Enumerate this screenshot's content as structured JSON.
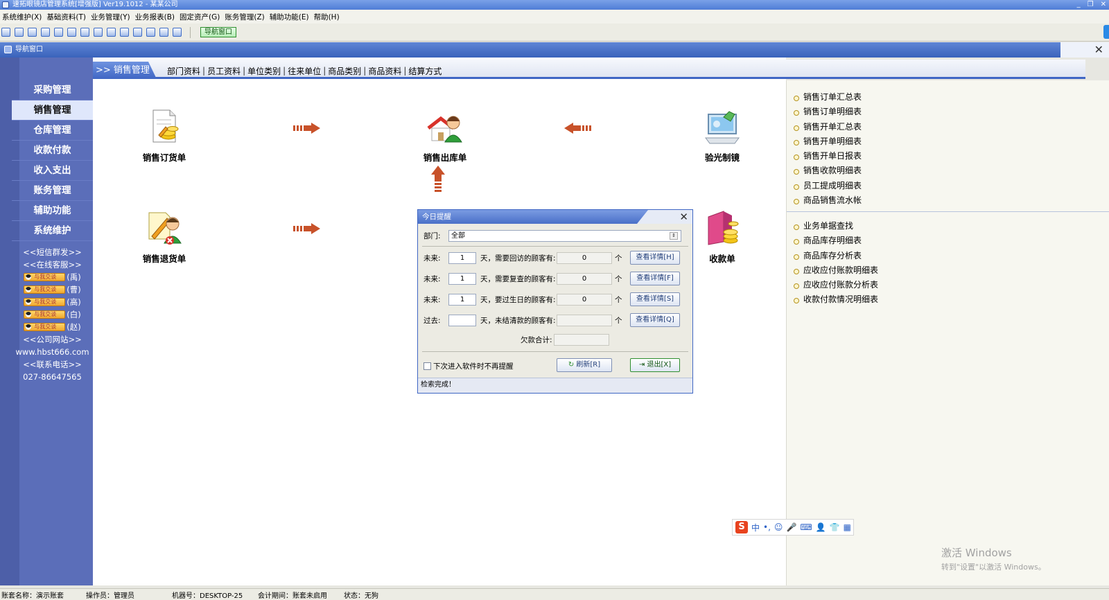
{
  "window": {
    "title": "速拓眼镜店管理系统[增强版] Ver19.1012 - 某某公司",
    "controls": [
      "_",
      "❐",
      "✕"
    ]
  },
  "menubar": [
    "系统维护(X)",
    "基础资料(T)",
    "业务管理(Y)",
    "业务报表(B)",
    "固定资产(G)",
    "账务管理(Z)",
    "辅助功能(E)",
    "帮助(H)"
  ],
  "toolbar": {
    "nav_button": "导航窗口"
  },
  "nav_window": {
    "title": "导航窗口",
    "close": "✕"
  },
  "sidebar": {
    "items": [
      "采购管理",
      "销售管理",
      "仓库管理",
      "收款付款",
      "收入支出",
      "账务管理",
      "辅助功能",
      "系统维护"
    ],
    "active_index": 1,
    "sms": "<<短信群发>>",
    "online": "<<在线客服>>",
    "qq_badge": "与我交谈",
    "qq_contacts": [
      "(禹)",
      "(曹)",
      "(高)",
      "(白)",
      "(赵)"
    ],
    "site_label": "<<公司网站>>",
    "site_url": "www.hbst666.com",
    "phone_label": "<<联系电话>>",
    "phone": "027-86647565"
  },
  "tabs": {
    "active": ">> 销售管理",
    "links": [
      "部门资料",
      "员工资料",
      "单位类别",
      "往来单位",
      "商品类别",
      "商品资料",
      "结算方式"
    ]
  },
  "flow": {
    "order": "销售订货单",
    "outbound": "销售出库单",
    "optometry": "验光制镜",
    "return": "销售退货单",
    "receipt": "收款单"
  },
  "right_panel": {
    "group1": [
      "销售订单汇总表",
      "销售订单明细表",
      "销售开单汇总表",
      "销售开单明细表",
      "销售开单日报表",
      "销售收款明细表",
      "员工提成明细表",
      "商品销售流水帐"
    ],
    "group2": [
      "业务单据查找",
      "商品库存明细表",
      "商品库存分析表",
      "应收应付账款明细表",
      "应收应付账款分析表",
      "收款付款情况明细表"
    ]
  },
  "dialog": {
    "title": "今日提醒",
    "close": "✕",
    "dept_label": "部门:",
    "dept_value": "全部",
    "rows": [
      {
        "prefix": "未来:",
        "days": "1",
        "text": "天，需要回访的顾客有:",
        "count": "0",
        "unit": "个",
        "button": "查看详情[H]"
      },
      {
        "prefix": "未来:",
        "days": "1",
        "text": "天，需要复查的顾客有:",
        "count": "0",
        "unit": "个",
        "button": "查看详情[F]"
      },
      {
        "prefix": "未来:",
        "days": "1",
        "text": "天，要过生日的顾客有:",
        "count": "0",
        "unit": "个",
        "button": "查看详情[S]"
      },
      {
        "prefix": "过去:",
        "days": "",
        "text": "天，未结清款的顾客有:",
        "count": "",
        "unit": "个",
        "button": "查看详情[Q]"
      }
    ],
    "debt_label": "欠款合计:",
    "debt_value": "",
    "no_remind": "下次进入软件时不再提醒",
    "refresh": "刷新[R]",
    "exit": "退出[X]",
    "status": "检索完成！"
  },
  "ime": {
    "logo": "S",
    "mode": "中"
  },
  "watermark": {
    "line1": "激活 Windows",
    "line2": "转到\"设置\"以激活 Windows。"
  },
  "statusbar": {
    "account": "账套名称：演示账套",
    "operator": "操作员：管理员",
    "machine": "机器号：DESKTOP-25",
    "period": "会计期间：账套未启用",
    "state": "状态：无狗"
  },
  "colors": {
    "accent": "#3f66c4",
    "sidebar": "#5b6eb9",
    "arrow": "#c8522a"
  }
}
